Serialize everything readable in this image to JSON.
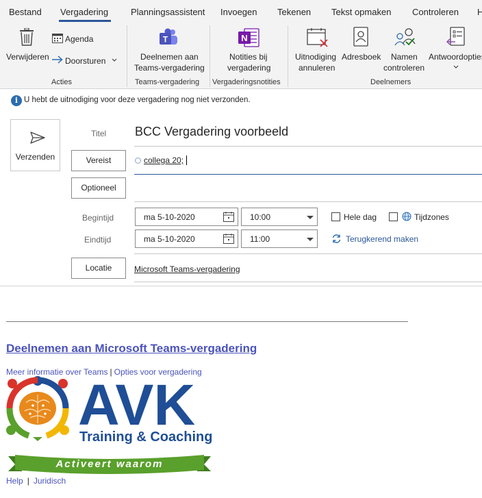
{
  "tabs": [
    "Bestand",
    "Vergadering",
    "Planningsassistent",
    "Invoegen",
    "Tekenen",
    "Tekst opmaken",
    "Controleren",
    "H"
  ],
  "ribbon": {
    "delete_label": "Verwijderen",
    "agenda_label": "Agenda",
    "forward_label": "Doorsturen",
    "group_actions": "Acties",
    "teams_join_line1": "Deelnemen aan",
    "teams_join_line2": "Teams-vergadering",
    "group_teams": "Teams-vergadering",
    "notes_line1": "Notities bij",
    "notes_line2": "vergadering",
    "group_notes": "Vergaderingsnotities",
    "cancel_line1": "Uitnodiging",
    "cancel_line2": "annuleren",
    "addressbook_label": "Adresboek",
    "checknames_line1": "Namen",
    "checknames_line2": "controleren",
    "responses_line1": "Antwoordopties",
    "group_attendees": "Deelnemers"
  },
  "info": {
    "message": "U hebt de uitnodiging voor deze vergadering nog niet verzonden."
  },
  "form": {
    "send_label": "Verzenden",
    "title_label": "Titel",
    "title_value": "BCC Vergadering voorbeeld",
    "required_label": "Vereist",
    "required_recipient": "collega 20;",
    "optional_label": "Optioneel",
    "start_label": "Begintijd",
    "end_label": "Eindtijd",
    "start_date": "ma 5-10-2020",
    "start_time": "10:00",
    "end_date": "ma 5-10-2020",
    "end_time": "11:00",
    "allday_label": "Hele dag",
    "timezones_label": "Tijdzones",
    "recurring_label": "Terugkerend maken",
    "location_label": "Locatie",
    "location_value": "Microsoft Teams-vergadering"
  },
  "body": {
    "join_link": "Deelnemen aan Microsoft Teams-vergadering",
    "more_info": "Meer informatie over Teams",
    "options": "Opties voor vergadering",
    "logo_text_main": "AVK",
    "logo_text_sub": "Training & Coaching",
    "logo_ribbon": "Activeert waarom",
    "help": "Help",
    "legal": "Juridisch"
  },
  "colors": {
    "tab_accent": "#2b579a",
    "link": "#4b53bc",
    "logo_blue": "#1f4e96",
    "logo_green": "#5aa02c",
    "logo_red": "#d9342b",
    "logo_yellow": "#f2b705",
    "logo_orange": "#e8891c"
  }
}
